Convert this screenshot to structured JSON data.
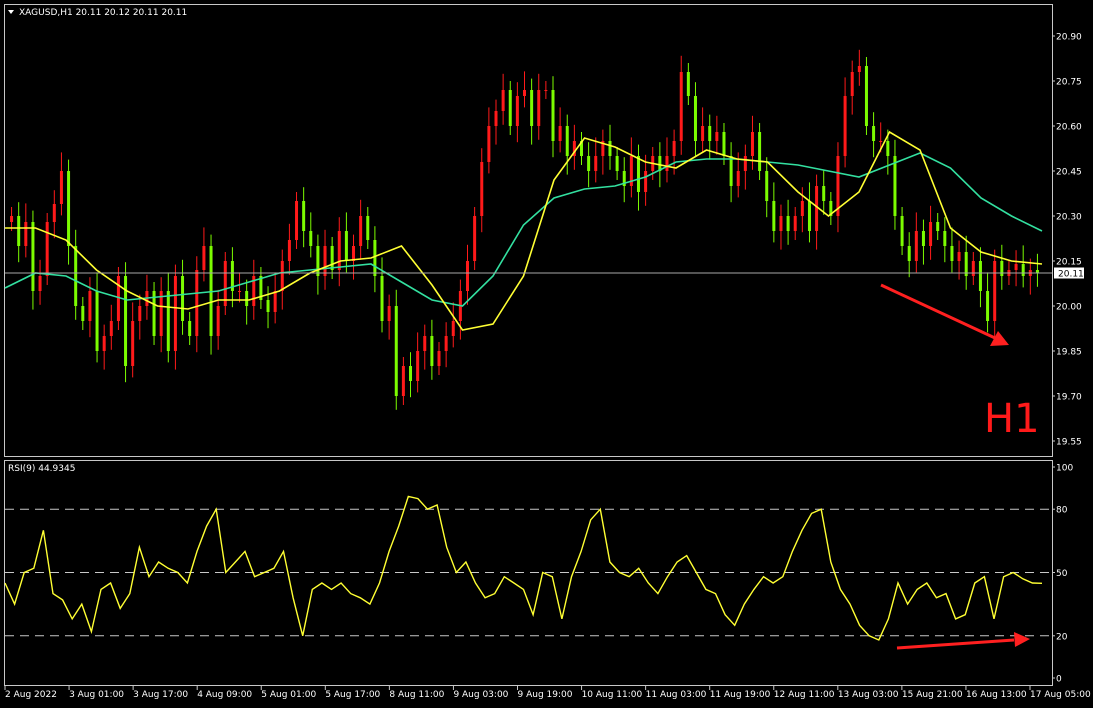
{
  "main": {
    "header": "XAGUSD,H1  20.11 20.12 20.11 20.11",
    "current_price": "20.11",
    "timeframe_mark": "H1"
  },
  "rsi": {
    "header": "RSI(9) 44.9345"
  },
  "colors": {
    "background": "#000000",
    "bull_candle": "#ff1a1a",
    "bear_candle": "#7cfc00",
    "ma_fast": "#ffff33",
    "ma_slow": "#33e0a0",
    "rsi_line": "#ffff33",
    "arrow": "#ff2020",
    "frame": "#c8c8c8"
  },
  "chart_data": [
    {
      "type": "line",
      "title": "XAGUSD,H1",
      "ylim": [
        19.51,
        20.95
      ],
      "y_ticks": [
        "20.90",
        "20.75",
        "20.60",
        "20.45",
        "20.30",
        "20.15",
        "20.00",
        "19.85",
        "19.70",
        "19.55"
      ],
      "x_ticks": [
        "2 Aug 2022",
        "3 Aug 01:00",
        "3 Aug 17:00",
        "4 Aug 09:00",
        "5 Aug 01:00",
        "5 Aug 17:00",
        "8 Aug 11:00",
        "9 Aug 03:00",
        "9 Aug 19:00",
        "10 Aug 11:00",
        "11 Aug 03:00",
        "11 Aug 19:00",
        "12 Aug 11:00",
        "13 Aug 03:00",
        "15 Aug 21:00",
        "16 Aug 13:00",
        "17 Aug 05:00"
      ],
      "last_price": 20.11,
      "legend": "none",
      "grid": false,
      "series": [
        {
          "style": "candles",
          "values": [
            20.3,
            20.2,
            20.28,
            20.05,
            20.1,
            20.28,
            20.34,
            20.45,
            20.2,
            20.0,
            19.95,
            20.05,
            19.85,
            19.9,
            19.95,
            20.1,
            19.8,
            19.95,
            20.0,
            20.05,
            19.9,
            20.05,
            19.85,
            20.1,
            19.95,
            19.9,
            20.12,
            20.2,
            19.9,
            20.0,
            20.15,
            20.05,
            20.05,
            20.0,
            20.1,
            20.02,
            19.98,
            20.05,
            20.15,
            20.22,
            20.35,
            20.25,
            20.2,
            20.1,
            20.2,
            20.12,
            20.25,
            20.15,
            20.2,
            20.3,
            20.22,
            20.1,
            19.95,
            20.0,
            19.7,
            19.8,
            19.75,
            19.85,
            19.9,
            19.8,
            19.85,
            19.9,
            19.95,
            20.05,
            20.15,
            20.3,
            20.48,
            20.6,
            20.65,
            20.72,
            20.6,
            20.7,
            20.72,
            20.6,
            20.72,
            20.72,
            20.55,
            20.6,
            20.5,
            20.55,
            20.5,
            20.45,
            20.5,
            20.55,
            20.5,
            20.45,
            20.4,
            20.5,
            20.38,
            20.45,
            20.5,
            20.45,
            20.5,
            20.55,
            20.78,
            20.7,
            20.55,
            20.6,
            20.55,
            20.58,
            20.5,
            20.4,
            20.45,
            20.5,
            20.58,
            20.45,
            20.35,
            20.25,
            20.3,
            20.25,
            20.3,
            20.35,
            20.25,
            20.4,
            20.35,
            20.3,
            20.5,
            20.7,
            20.78,
            20.8,
            20.6,
            20.55,
            20.55,
            20.5,
            20.3,
            20.2,
            20.15,
            20.25,
            20.2,
            20.28,
            20.25,
            20.2,
            20.15,
            20.18,
            20.1,
            20.15,
            20.05,
            19.95,
            20.15,
            20.1,
            20.12,
            20.14,
            20.1,
            20.12,
            20.11
          ]
        },
        {
          "name": "",
          "style": "line",
          "values": [
            20.26,
            20.26,
            20.22,
            20.12,
            20.05,
            20.0,
            19.99,
            20.02,
            20.02,
            20.05,
            20.11,
            20.15,
            20.16,
            20.2,
            20.07,
            19.92,
            19.94,
            20.1,
            20.42,
            20.56,
            20.53,
            20.48,
            20.46,
            20.52,
            20.49,
            20.48,
            20.38,
            20.3,
            20.38,
            20.58,
            20.52,
            20.26,
            20.18,
            20.15,
            20.14
          ]
        },
        {
          "name": "",
          "style": "line",
          "values": [
            20.06,
            20.11,
            20.1,
            20.05,
            20.02,
            20.03,
            20.04,
            20.05,
            20.08,
            20.11,
            20.12,
            20.13,
            20.14,
            20.08,
            20.02,
            20.0,
            20.1,
            20.27,
            20.36,
            20.39,
            20.4,
            20.43,
            20.48,
            20.49,
            20.49,
            20.48,
            20.47,
            20.45,
            20.43,
            20.47,
            20.51,
            20.46,
            20.36,
            20.3,
            20.25
          ]
        }
      ]
    },
    {
      "type": "line",
      "title": "RSI(9)",
      "last_value": 44.9345,
      "ylim": [
        0,
        100
      ],
      "y_ticks": [
        "100",
        "80",
        "50",
        "20",
        "0"
      ],
      "levels": [
        80,
        50,
        20
      ],
      "series": [
        {
          "name": "",
          "values": [
            45,
            35,
            50,
            52,
            70,
            40,
            37,
            28,
            35,
            22,
            42,
            45,
            33,
            40,
            62,
            48,
            55,
            52,
            50,
            45,
            60,
            72,
            80,
            50,
            55,
            60,
            48,
            50,
            52,
            60,
            38,
            20,
            42,
            45,
            42,
            45,
            40,
            38,
            35,
            45,
            60,
            72,
            86,
            85,
            80,
            82,
            62,
            50,
            55,
            45,
            38,
            40,
            48,
            45,
            42,
            30,
            50,
            48,
            28,
            48,
            60,
            75,
            80,
            55,
            50,
            48,
            52,
            45,
            40,
            48,
            55,
            58,
            50,
            42,
            40,
            30,
            25,
            35,
            42,
            48,
            45,
            48,
            60,
            70,
            78,
            80,
            55,
            42,
            35,
            25,
            20,
            18,
            28,
            45,
            35,
            42,
            45,
            38,
            40,
            28,
            30,
            45,
            48,
            28,
            48,
            50,
            47,
            45,
            44.9
          ]
        }
      ]
    }
  ]
}
